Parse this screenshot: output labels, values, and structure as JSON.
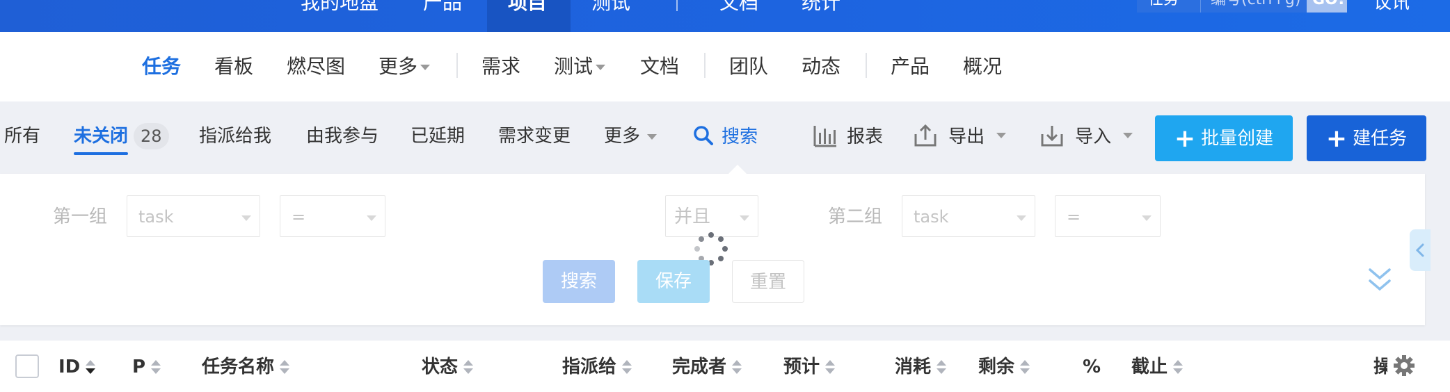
{
  "top_nav": {
    "items": [
      "我的地盘",
      "产品",
      "项目",
      "测试",
      "文档",
      "统计"
    ],
    "active": "项目",
    "search_category": "任务",
    "search_placeholder": "编号(ctrl+g)",
    "go_label": "GO!",
    "right_link": "议讯"
  },
  "sub_nav": {
    "items": [
      {
        "label": "任务",
        "active": true
      },
      {
        "label": "看板"
      },
      {
        "label": "燃尽图"
      },
      {
        "label": "更多",
        "dropdown": true
      },
      {
        "label": "需求"
      },
      {
        "label": "测试",
        "dropdown": true
      },
      {
        "label": "文档"
      },
      {
        "label": "团队"
      },
      {
        "label": "动态"
      },
      {
        "label": "产品"
      },
      {
        "label": "概况"
      }
    ]
  },
  "filter_bar": {
    "items": [
      {
        "label": "所有"
      },
      {
        "label": "未关闭",
        "active": true,
        "count": "28"
      },
      {
        "label": "指派给我"
      },
      {
        "label": "由我参与"
      },
      {
        "label": "已延期"
      },
      {
        "label": "需求变更"
      },
      {
        "label": "更多",
        "dropdown": true
      }
    ],
    "search_label": "搜索",
    "report_label": "报表",
    "export_label": "导出",
    "import_label": "导入",
    "batch_create_label": "批量创建",
    "create_task_label": "建任务"
  },
  "search_panel": {
    "group1_label": "第一组",
    "group2_label": "第二组",
    "group1_field": "task",
    "group1_operator": "=",
    "group2_field": "task",
    "group2_operator": "=",
    "logic": "并且",
    "search_button": "搜索",
    "save_button": "保存",
    "reset_button": "重置"
  },
  "table_header": {
    "columns": [
      "ID",
      "P",
      "任务名称",
      "状态",
      "指派给",
      "完成者",
      "预计",
      "消耗",
      "剩余",
      "%",
      "截止",
      "操"
    ]
  },
  "colors": {
    "primary": "#1d6fe0",
    "nav_bg": "#1f5fd6",
    "batch_create": "#1fa6f0",
    "create_task": "#1863d8"
  }
}
